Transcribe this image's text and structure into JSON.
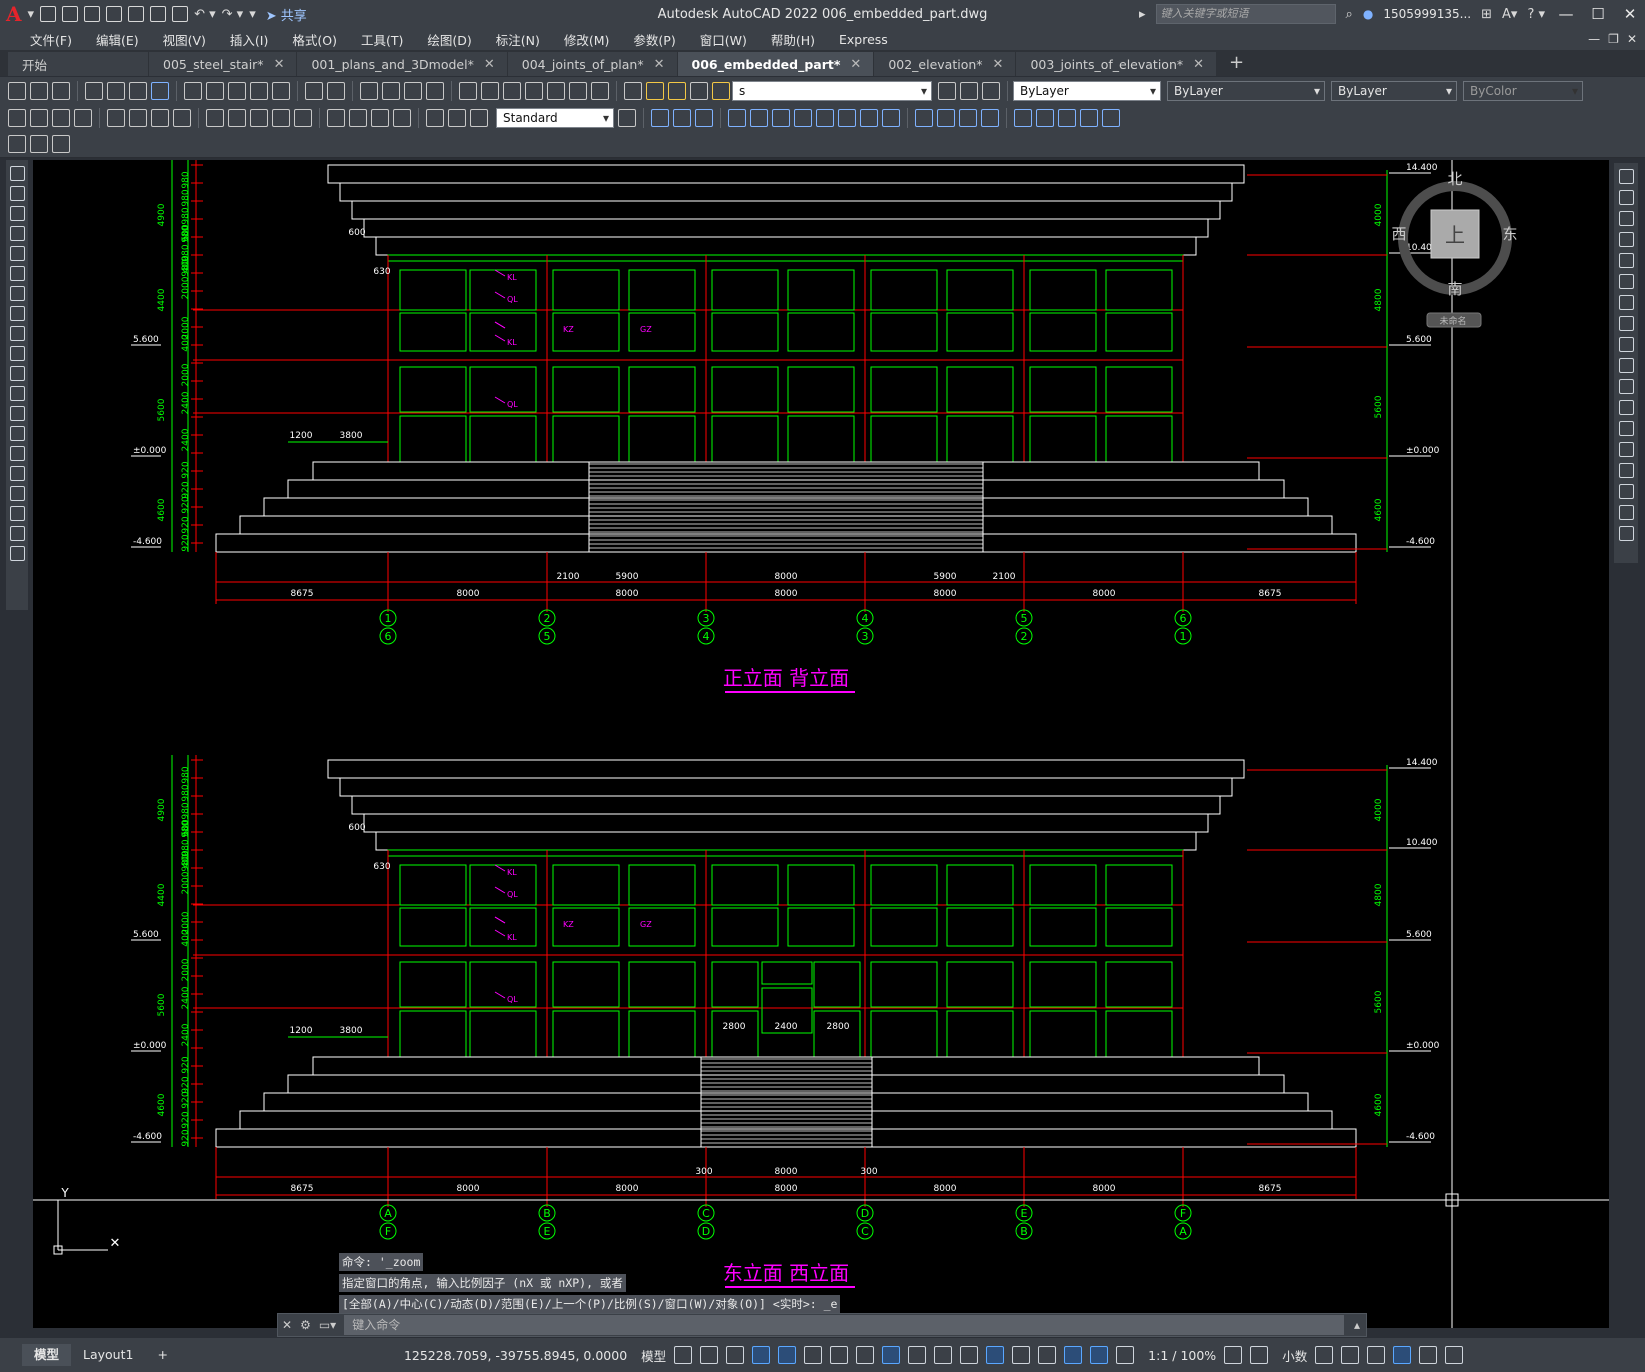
{
  "app": {
    "logo": "A",
    "title": "Autodesk AutoCAD 2022    006_embedded_part.dwg",
    "share_label": "共享",
    "search_placeholder": "键入关键字或短语",
    "user": "1505999135...",
    "win_min": "—",
    "win_max": "☐",
    "win_close": "✕"
  },
  "menu": [
    "文件(F)",
    "编辑(E)",
    "视图(V)",
    "插入(I)",
    "格式(O)",
    "工具(T)",
    "绘图(D)",
    "标注(N)",
    "修改(M)",
    "参数(P)",
    "窗口(W)",
    "帮助(H)",
    "Express"
  ],
  "tabs": [
    {
      "label": "开始",
      "closable": false
    },
    {
      "label": "005_steel_stair*",
      "closable": true
    },
    {
      "label": "001_plans_and_3Dmodel*",
      "closable": true
    },
    {
      "label": "004_joints_of_plan*",
      "closable": true
    },
    {
      "label": "006_embedded_part*",
      "closable": true,
      "active": true
    },
    {
      "label": "002_elevation*",
      "closable": true
    },
    {
      "label": "003_joints_of_elevation*",
      "closable": true
    }
  ],
  "toolbar": {
    "layer_value": "s",
    "color_value": "ByLayer",
    "linetype_value": "ByLayer",
    "lineweight_value": "ByLayer",
    "plotstyle_value": "ByColor",
    "dimstyle_value": "Standard"
  },
  "compass": {
    "north": "北",
    "south": "南",
    "east": "东",
    "west": "西",
    "top": "上",
    "ucs": "未命名"
  },
  "drawing": {
    "top": {
      "title": "正立面  背立面",
      "levels": [
        "14.400",
        "10.400",
        "5.600",
        "±0.000",
        "-4.600"
      ],
      "left_levels": [
        "5.600",
        "±0.000",
        "-4.600"
      ],
      "left_dims": [
        "980",
        "980",
        "980",
        "980",
        "980",
        "600",
        "980",
        "4900",
        "400",
        "2000",
        "4400",
        "2000",
        "400",
        "2000",
        "2400",
        "5600",
        "2400",
        "920",
        "920",
        "920",
        "920",
        "920",
        "4600"
      ],
      "right_dims": [
        "4000",
        "4800",
        "5600",
        "4600"
      ],
      "small_dims": [
        "600",
        "630",
        "1200",
        "3800"
      ],
      "dims_bottom_inner": [
        "2100",
        "5900",
        "8000",
        "5900",
        "2100"
      ],
      "dims_bottom": [
        "8675",
        "8000",
        "8000",
        "8000",
        "8000",
        "8000",
        "8675"
      ],
      "axes_upper": [
        "1",
        "2",
        "3",
        "4",
        "5",
        "6"
      ],
      "axes_lower": [
        "6",
        "5",
        "4",
        "3",
        "2",
        "1"
      ],
      "tags": [
        "KL",
        "QL",
        "KL",
        "KZ",
        "GZ",
        "QL"
      ]
    },
    "bottom": {
      "title": "东立面  西立面",
      "levels": [
        "14.400",
        "10.400",
        "5.600",
        "±0.000",
        "-4.600"
      ],
      "left_levels": [
        "5.600",
        "±0.000",
        "-4.600"
      ],
      "left_dims": [
        "980",
        "980",
        "980",
        "980",
        "980",
        "600",
        "980",
        "4900",
        "400",
        "2000",
        "4400",
        "2000",
        "400",
        "2000",
        "2400",
        "5600",
        "2400",
        "920",
        "920",
        "920",
        "920",
        "920",
        "4600"
      ],
      "right_dims": [
        "4000",
        "4800",
        "5600",
        "4600"
      ],
      "small_dims": [
        "600",
        "630",
        "1200",
        "3800"
      ],
      "door_dims": [
        "2800",
        "2400",
        "2800"
      ],
      "dims_bottom_inner": [
        "300",
        "8000",
        "300"
      ],
      "dims_bottom": [
        "8675",
        "8000",
        "8000",
        "8000",
        "8000",
        "8000",
        "8675"
      ],
      "axes_upper": [
        "A",
        "B",
        "C",
        "D",
        "E",
        "F"
      ],
      "axes_lower": [
        "F",
        "E",
        "D",
        "C",
        "B",
        "A"
      ],
      "tags": [
        "KL",
        "QL",
        "KL",
        "KZ",
        "GZ",
        "QL"
      ]
    },
    "ucs_y": "Y"
  },
  "command": {
    "history": [
      "命令: '_zoom",
      "指定窗口的角点, 输入比例因子 (nX 或 nXP), 或者",
      "[全部(A)/中心(C)/动态(D)/范围(E)/上一个(P)/比例(S)/窗口(W)/对象(O)] <实时>: _e"
    ],
    "placeholder": "键入命令"
  },
  "status": {
    "tab_model": "模型",
    "tab_layout": "Layout1",
    "add": "+",
    "coords": "125228.7059, -39755.8945, 0.0000",
    "space": "模型",
    "scale": "1:1 / 100%",
    "units": "小数"
  },
  "colors": {
    "dim_red": "#ff0000",
    "window_green": "#00ff00",
    "tag_magenta": "#ff00ff",
    "outline_white": "#ffffff"
  }
}
